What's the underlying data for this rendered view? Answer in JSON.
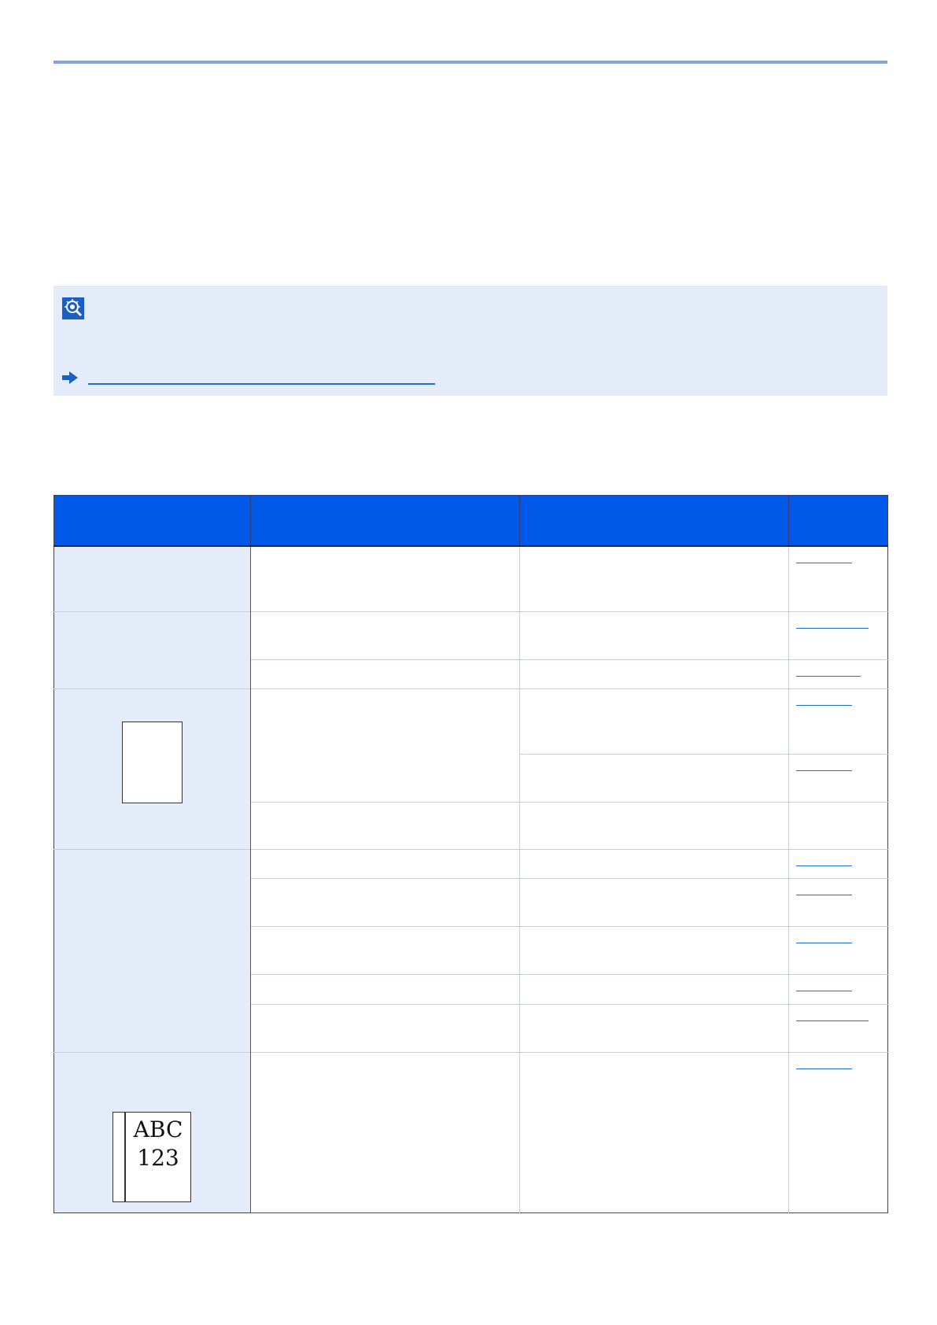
{
  "note": {
    "icon": "lightbulb-note-icon",
    "arrow_icon": "arrow-right-icon",
    "link_text": ""
  },
  "colors": {
    "header_blue": "#0059e8",
    "note_background": "#e4ecf9",
    "top_rule": "#7ea7e2",
    "link_blue": "#1f6fd1"
  },
  "table": {
    "headers": [
      "",
      "",
      "",
      ""
    ],
    "thumbnail_text": {
      "line1": "ABC",
      "line2": "123"
    }
  }
}
